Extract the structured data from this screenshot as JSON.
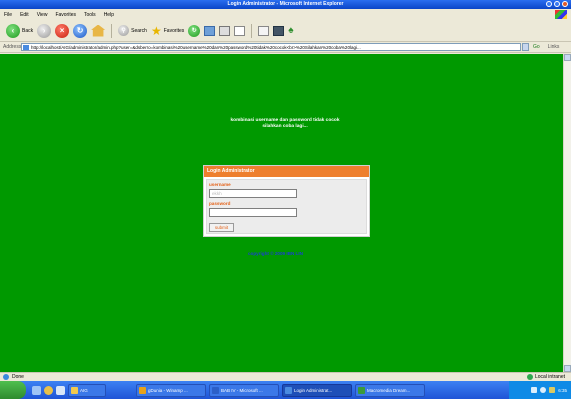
{
  "window": {
    "title": "Login Administrator - Microsoft Internet Explorer"
  },
  "menu": [
    "File",
    "Edit",
    "View",
    "Favorites",
    "Tools",
    "Help"
  ],
  "toolbar": {
    "back_label": "Back",
    "search_label": "Search",
    "favorites_label": "Favorites"
  },
  "address": {
    "label": "Address",
    "url": "http://localhost/AIG/administrator/admin.php?user=&dsberro=kombinasi%20username%20dan%20password%20tidak%20cocok<br>%20Silahkan%20coba%20lagi...",
    "go_label": "Go",
    "links_label": "Links"
  },
  "page": {
    "error_line1": "kombinasi username dan password tidak cocok",
    "error_line2": "silahkan coba lagi...",
    "login_title": "Login Administrator",
    "username_label": "username",
    "username_value": "ekkh",
    "password_label": "password",
    "password_value": "",
    "submit_label": "submit",
    "copyright": "copyright © 2009 IBN LIN"
  },
  "statusbar": {
    "status": "Done",
    "zone": "Local intranet"
  },
  "taskbar": {
    "buttons": [
      {
        "label": "AIG",
        "color": "#f2c94c"
      },
      {
        "label": "gDunia - Winamp ...",
        "color": "#e8a21a"
      },
      {
        "label": "BAB IV - Microsoft ...",
        "color": "#2b5fc8"
      },
      {
        "label": "Login Administrat...",
        "color": "#4a8be0",
        "active": true
      },
      {
        "label": "Macromedia Dream...",
        "color": "#3a9a3a"
      }
    ],
    "clock": "6:35"
  }
}
